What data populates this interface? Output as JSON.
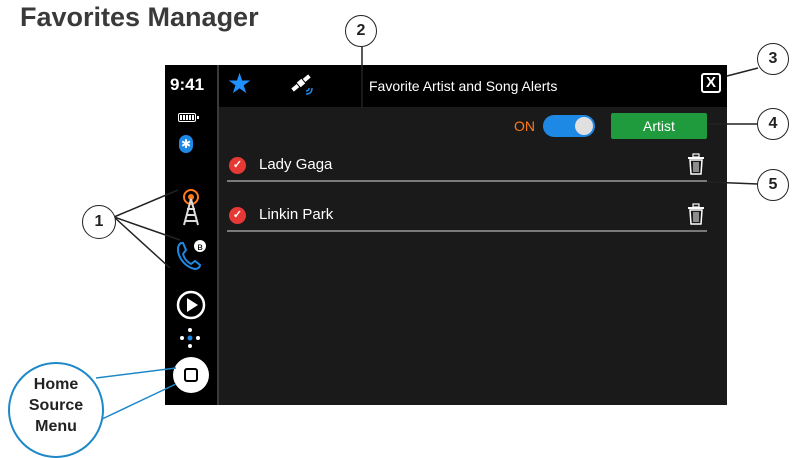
{
  "page_title": "Favorites Manager",
  "sidebar": {
    "time": "9:41",
    "battery_icon": "battery-icon",
    "bluetooth_icon": "bluetooth-icon",
    "bluetooth_glyph": "ʙ",
    "items": [
      {
        "name": "radio-tower-icon"
      },
      {
        "name": "phone-bluetooth-icon"
      },
      {
        "name": "play-icon"
      },
      {
        "name": "nav-dots-icon"
      },
      {
        "name": "home-button"
      }
    ]
  },
  "topbar": {
    "favorites_icon": "star-icon",
    "satellite_icon": "satellite-icon",
    "title": "Favorite Artist and Song Alerts",
    "close_label": "X"
  },
  "controls": {
    "toggle_label": "ON",
    "toggle_state": true,
    "artist_button": "Artist"
  },
  "list": [
    {
      "label": "Lady Gaga",
      "checked": true
    },
    {
      "label": "Linkin Park",
      "checked": true
    }
  ],
  "callouts": {
    "c1": "1",
    "c2": "2",
    "c3": "3",
    "c4": "4",
    "c5": "5",
    "home_line1": "Home",
    "home_line2": "Source",
    "home_line3": "Menu"
  },
  "colors": {
    "accent_blue": "#1e88e5",
    "alert_orange": "#ff7a1a",
    "artist_green": "#1f9a3c",
    "check_red": "#e63935"
  }
}
